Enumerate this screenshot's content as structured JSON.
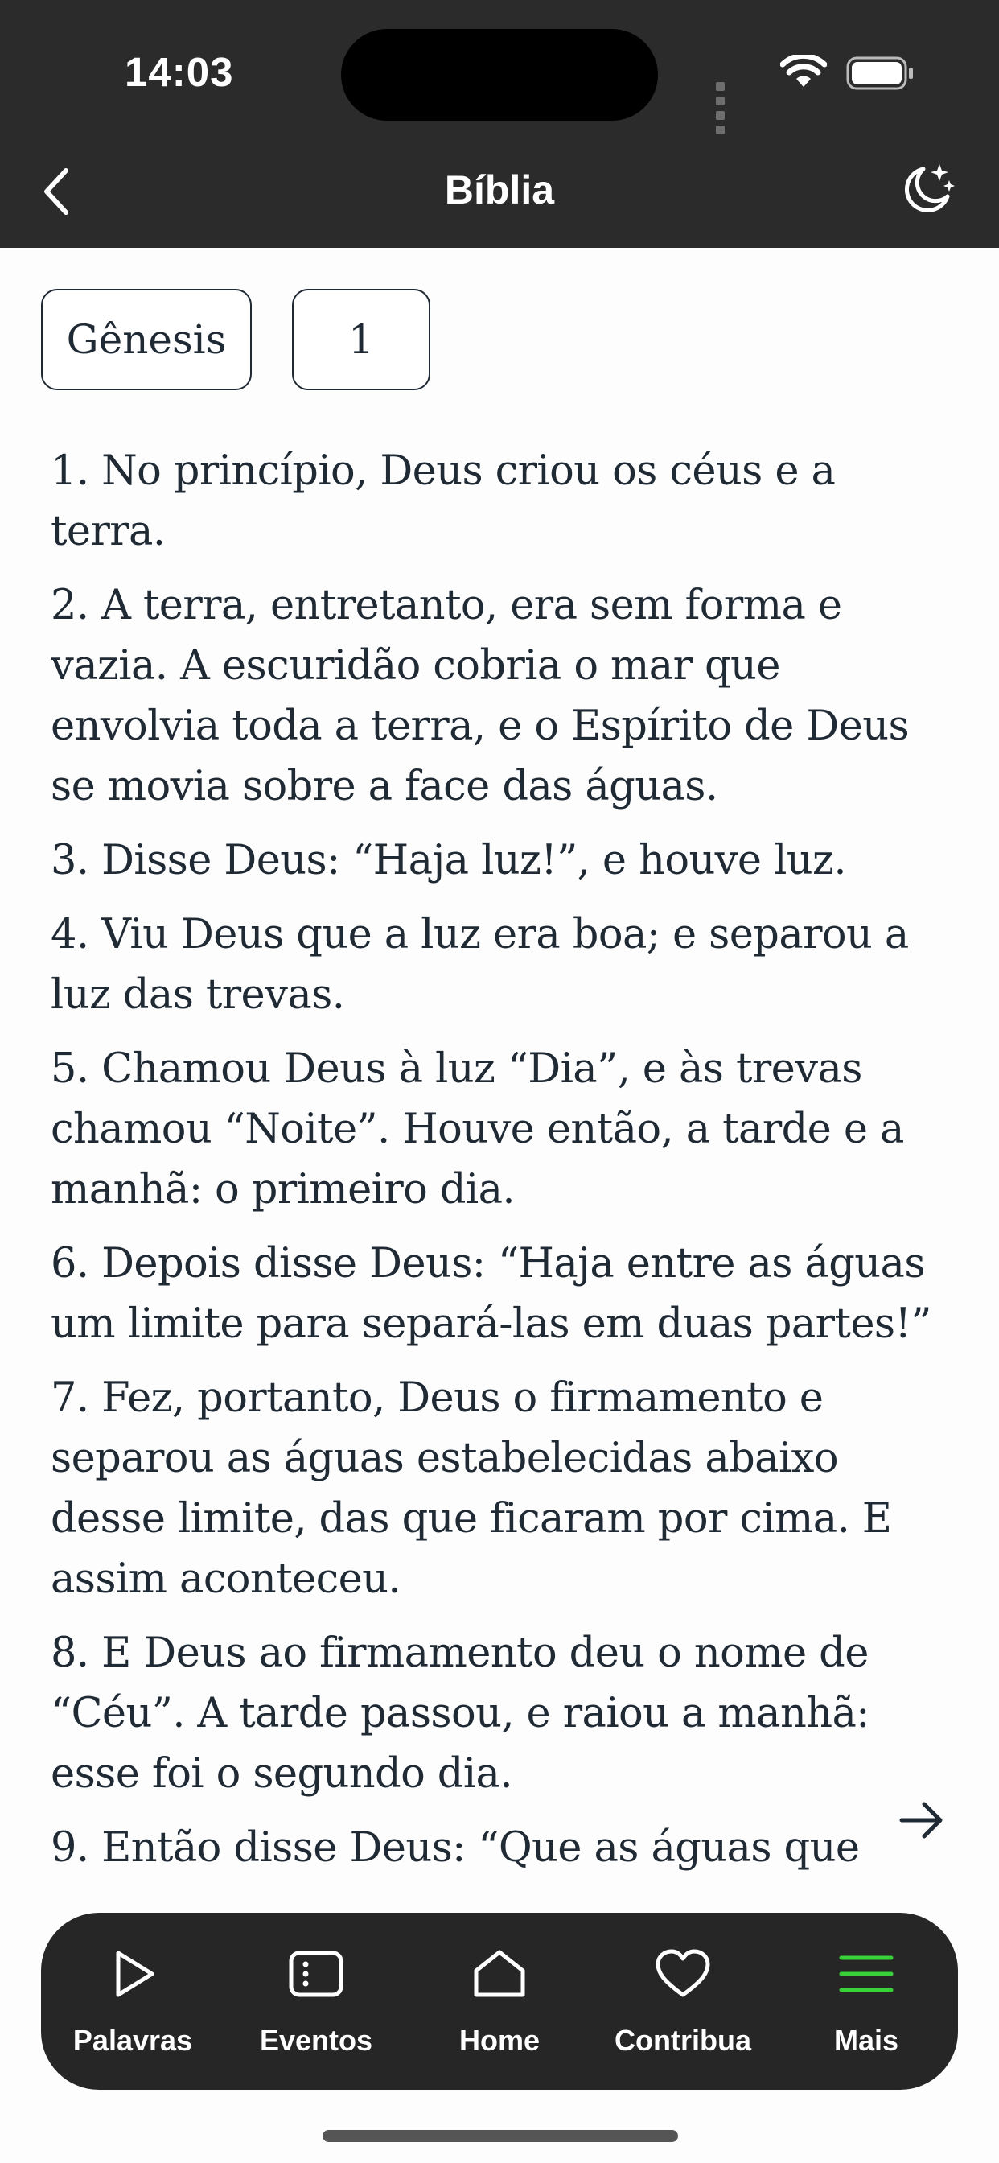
{
  "status": {
    "time": "14:03"
  },
  "nav": {
    "title": "Bíblia",
    "back_icon": "chevron-left-icon",
    "theme_icon": "moon-stars-icon"
  },
  "selectors": {
    "book": "Gênesis",
    "chapter": "1"
  },
  "verses": [
    "1. No princípio, Deus criou os céus e a terra.",
    "2. A terra, entretanto, era sem forma e vazia. A escuridão cobria o mar que envolvia toda a terra, e o Espírito de Deus se movia sobre a face das águas.",
    "3. Disse Deus: “Haja luz!”, e houve luz.",
    "4. Viu Deus que a luz era boa; e separou a luz das trevas.",
    "5. Chamou Deus à luz “Dia”, e às trevas chamou “Noite”. Houve então, a tarde e a manhã: o primeiro dia.",
    "6. Depois disse Deus: “Haja entre as águas um limite para separá-las em duas partes!”",
    "7. Fez, portanto, Deus o firmamento e separou as águas estabelecidas abaixo desse limite, das que ficaram por cima. E assim aconteceu.",
    "8. E Deus ao firmamento deu o nome de “Céu”. A tarde passou, e raiou a manhã: esse foi o segundo dia.",
    "9. Então disse Deus: “Que as águas que"
  ],
  "tabs": [
    {
      "label": "Palavras",
      "icon": "play-icon"
    },
    {
      "label": "Eventos",
      "icon": "events-icon"
    },
    {
      "label": "Home",
      "icon": "home-icon"
    },
    {
      "label": "Contribua",
      "icon": "heart-icon"
    },
    {
      "label": "Mais",
      "icon": "menu-icon"
    }
  ],
  "colors": {
    "header_bg": "#2b2b2b",
    "tabbar_bg": "#262626",
    "accent": "#3ad23a",
    "text": "#1f2a35"
  }
}
